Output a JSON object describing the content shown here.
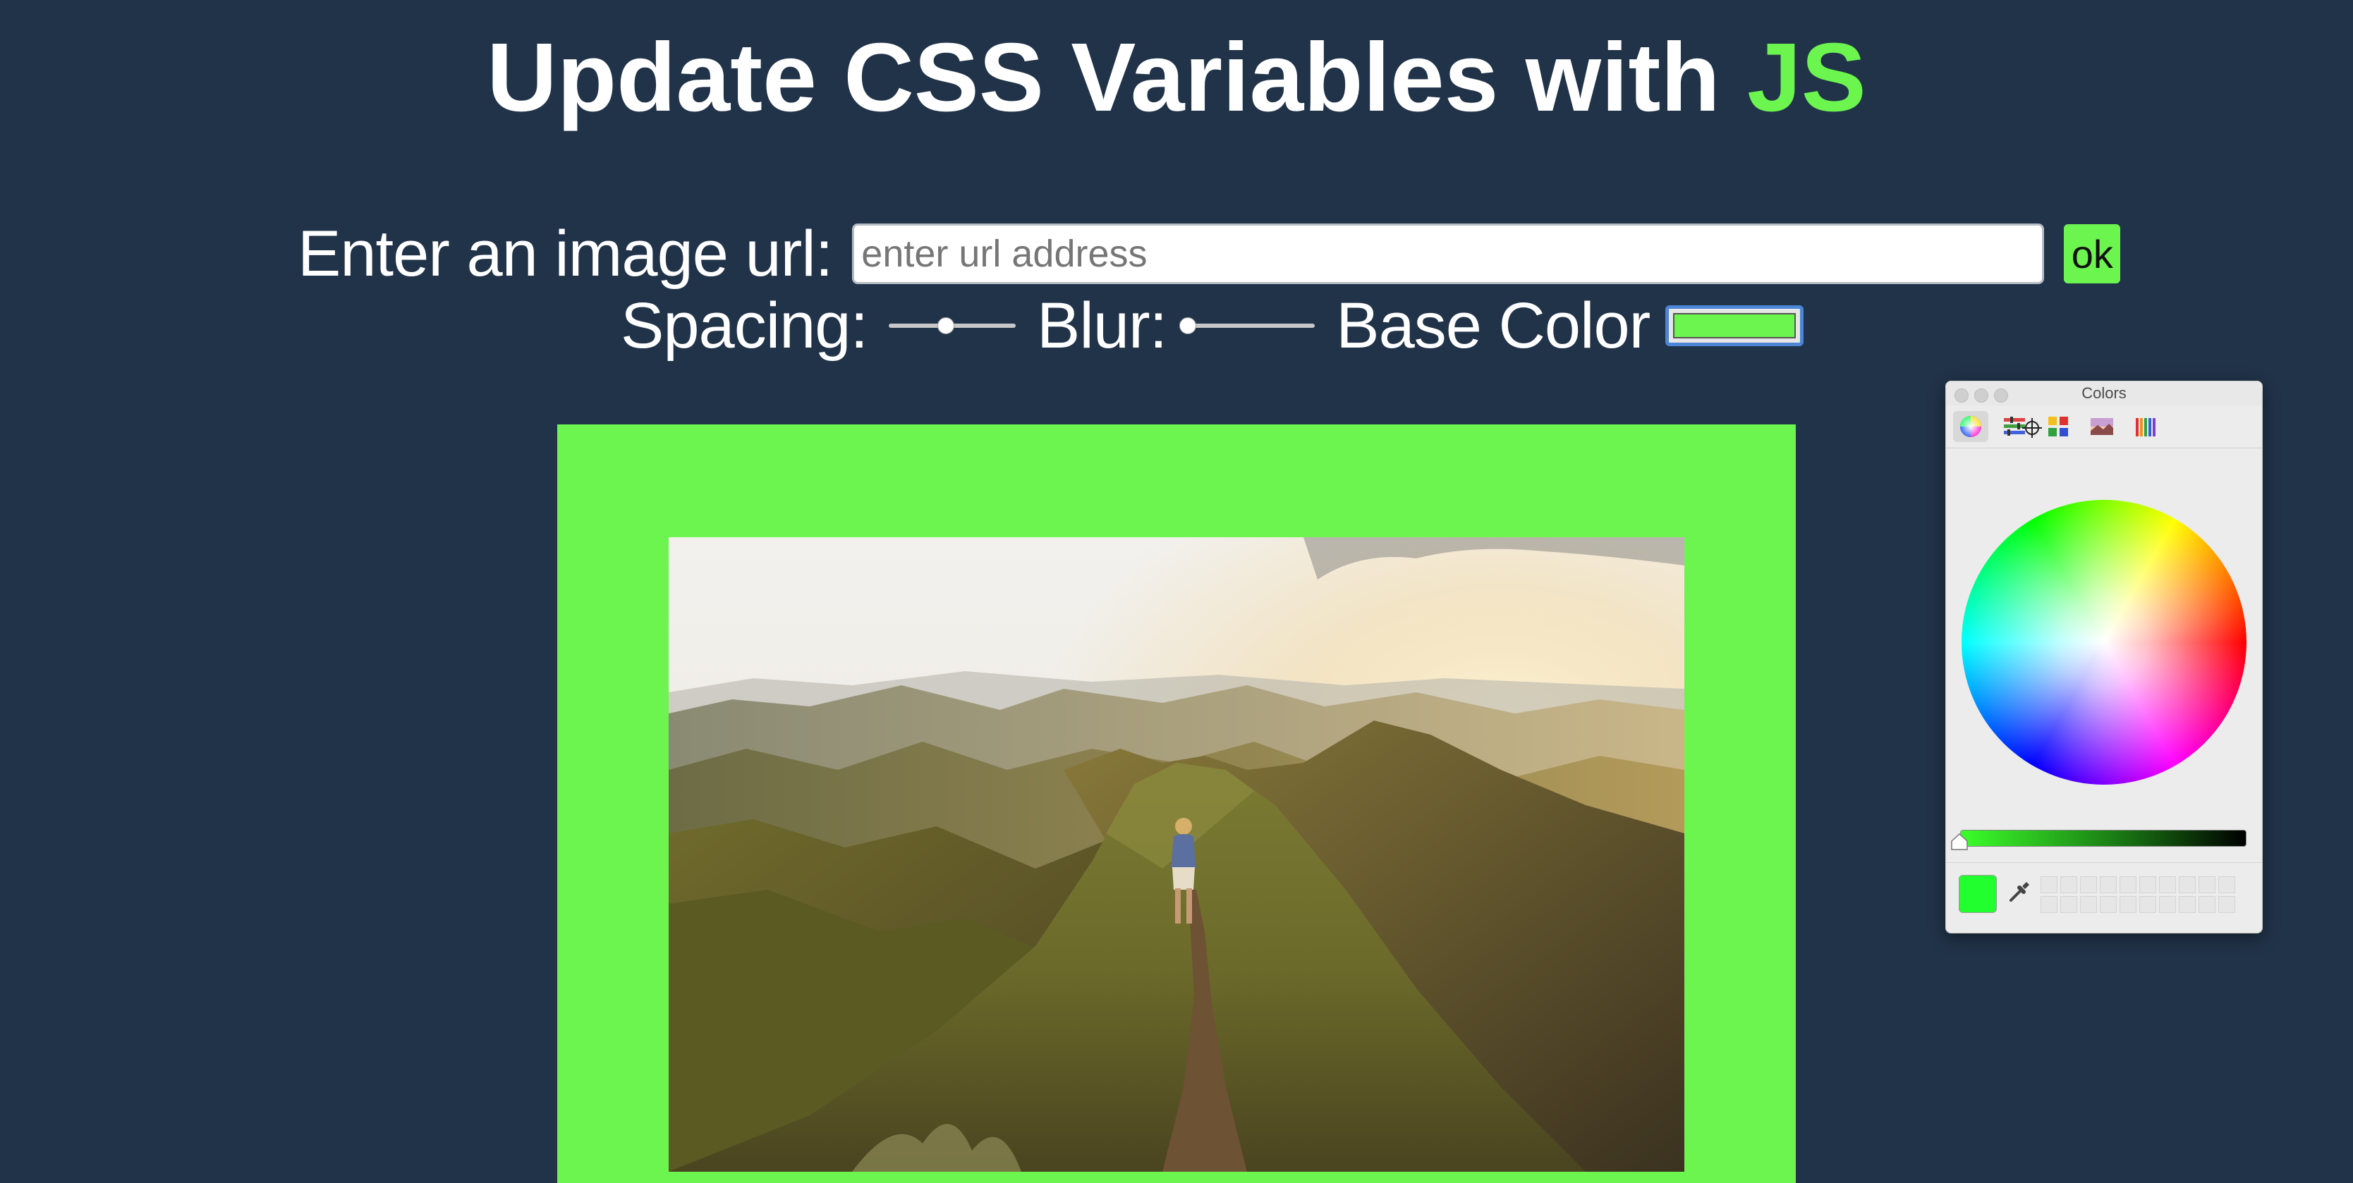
{
  "header": {
    "title_main": "Update CSS Variables with ",
    "title_accent": "JS"
  },
  "url_row": {
    "label": "Enter an image url:",
    "placeholder": "enter url address",
    "value": "",
    "ok_label": "ok"
  },
  "controls": {
    "spacing_label": "Spacing:",
    "spacing_value": 0.45,
    "blur_label": "Blur:",
    "blur_value": 0,
    "base_color_label": "Base Color",
    "base_color": "#6cf54e"
  },
  "colors_panel": {
    "title": "Colors",
    "selected_tab": "color-wheel",
    "tabs": [
      "color-wheel",
      "color-sliders",
      "color-palettes",
      "image-palettes",
      "pencils"
    ],
    "current_color": "#22ff2e"
  },
  "theme": {
    "background": "#213349",
    "accent": "#6cf54e"
  }
}
